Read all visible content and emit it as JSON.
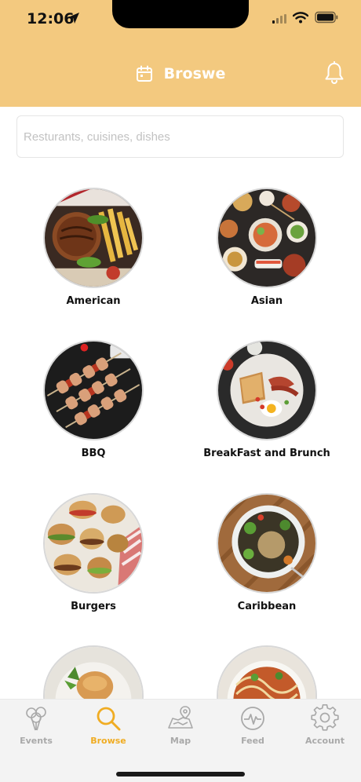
{
  "status": {
    "time": "12:06"
  },
  "header": {
    "title": "Broswe",
    "calendar_icon": "calendar-icon",
    "bell_icon": "bell-icon"
  },
  "search": {
    "placeholder": "Resturants, cuisines, dishes",
    "value": ""
  },
  "categories": [
    {
      "label": "American"
    },
    {
      "label": "Asian"
    },
    {
      "label": "BBQ"
    },
    {
      "label": "BreakFast and Brunch"
    },
    {
      "label": "Burgers"
    },
    {
      "label": "Caribbean"
    },
    {
      "label": ""
    },
    {
      "label": ""
    }
  ],
  "tabs": [
    {
      "label": "Events",
      "icon": "balloons-icon"
    },
    {
      "label": "Browse",
      "icon": "search-icon",
      "active": true
    },
    {
      "label": "Map",
      "icon": "map-icon"
    },
    {
      "label": "Feed",
      "icon": "pulse-icon"
    },
    {
      "label": "Account",
      "icon": "gear-icon"
    }
  ],
  "colors": {
    "header": "#f3c97f",
    "accent": "#f0ac22",
    "tab_inactive": "#a9a9a9"
  }
}
